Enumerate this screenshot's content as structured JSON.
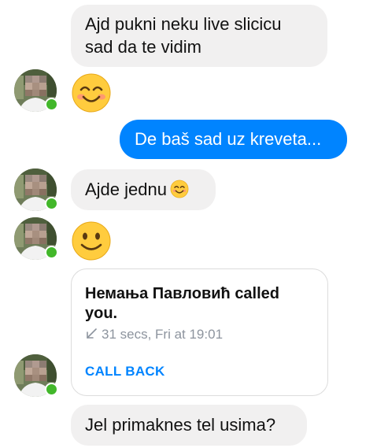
{
  "messages": {
    "m1": {
      "text_line1": "Ajd pukni neku live slicicu",
      "text_line2": "sad da te vidim"
    },
    "m2": {
      "emoji": "smiling-face-with-smiling-eyes"
    },
    "m3": {
      "text": "De baš sad uz kreveta..."
    },
    "m4": {
      "text": "Ajde jednu",
      "emoji": "smiling-face-with-smiling-eyes"
    },
    "m5": {
      "emoji": "slightly-smiling-face"
    },
    "m6": {
      "caller_line1": "Немања Павловић called",
      "caller_line2": "you.",
      "meta": "31 secs, Fri at 19:01",
      "call_back_label": "CALL BACK",
      "icon": "incoming-call-arrow-icon"
    },
    "m7": {
      "text": "Jel primaknes tel usima?"
    }
  },
  "colors": {
    "outgoing_bubble": "#0084ff",
    "incoming_bubble": "#f1f0f0",
    "online_dot": "#42b72a",
    "call_back": "#0084ff",
    "meta_text": "#8d949e"
  }
}
